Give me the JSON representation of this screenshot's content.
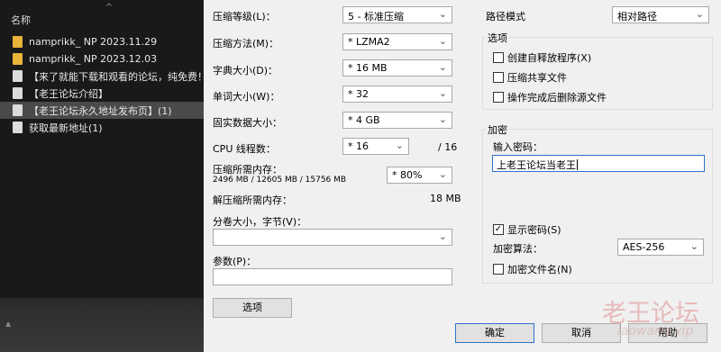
{
  "explorer": {
    "column_header": "名称",
    "collapse_glyph": "^",
    "items": [
      {
        "name": "namprikk_ NP 2023.11.29",
        "type": "folder"
      },
      {
        "name": "namprikk_ NP 2023.12.03",
        "type": "folder"
      },
      {
        "name": "【来了就能下载和观看的论坛，纯免费！...",
        "type": "file"
      },
      {
        "name": "【老王论坛介绍】",
        "type": "file"
      },
      {
        "name": "【老王论坛永久地址发布页】(1)",
        "type": "file",
        "selected": true
      },
      {
        "name": "获取最新地址(1)",
        "type": "file"
      }
    ],
    "scroll_glyph": "▲"
  },
  "dialog": {
    "level_label": "压缩等级(L)：",
    "level_value": "5 - 标准压缩",
    "method_label": "压缩方法(M)：",
    "method_value": "* LZMA2",
    "dict_label": "字典大小(D)：",
    "dict_value": "* 16 MB",
    "word_label": "单词大小(W)：",
    "word_value": "* 32",
    "solid_label": "固实数据大小：",
    "solid_value": "* 4 GB",
    "cpu_label": "CPU 线程数：",
    "cpu_value": "* 16",
    "cpu_total": "/ 16",
    "mem_label": "压缩所需内存：",
    "mem_detail": "2496 MB / 12605 MB / 15756 MB",
    "mem_value": "* 80%",
    "decomp_label": "解压缩所需内存：",
    "decomp_value": "18 MB",
    "split_label": "分卷大小，字节(V)：",
    "split_value": "",
    "params_label": "参数(P)：",
    "params_value": "",
    "options_button": "选项",
    "path_label": "路径模式",
    "path_value": "相对路径",
    "options_group": "选项",
    "opt_sfx": "创建自释放程序(X)",
    "opt_shared": "压缩共享文件",
    "opt_delete": "操作完成后删除源文件",
    "encrypt_group": "加密",
    "password_label": "输入密码：",
    "password_value": "上老王论坛当老王",
    "show_password": "显示密码(S)",
    "algo_label": "加密算法：",
    "algo_value": "AES-256",
    "encrypt_names": "加密文件名(N)",
    "ok_button": "确定",
    "cancel_button": "取消",
    "help_button": "帮助"
  },
  "watermark": {
    "line1": "老王论坛",
    "line2": "laowang.vip"
  },
  "icons": {
    "dropdown": "chevron-down-icon",
    "folder": "folder-icon",
    "file": "file-icon",
    "check": "check-icon"
  },
  "colors": {
    "explorer_bg": "#191919",
    "dialog_bg": "#f0f0f0",
    "focus_border": "#2a72c9",
    "watermark": "#dc7878"
  }
}
